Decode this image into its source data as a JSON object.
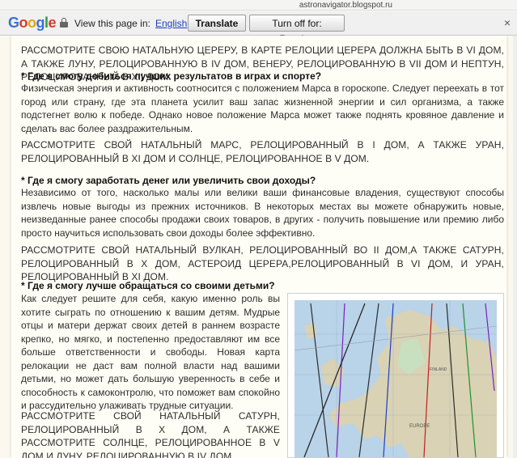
{
  "browser": {
    "url": "astronavigator.blogspot.ru"
  },
  "translate_bar": {
    "logo": "Google",
    "view_text": "View this page in:",
    "language": "English",
    "translate_label": "Translate",
    "turn_off_label": "Turn off for: Russian",
    "close": "×"
  },
  "article": {
    "p0": "РАССМОТРИТЕ СВОЮ НАТАЛЬНУЮ ЦЕРЕРУ, В КАРТЕ РЕЛОЦИИ ЦЕРЕРА ДОЛЖНА БЫТЬ В VI ДОМ, А ТАКЖЕ ЛУНУ, РЕЛОЦИРОВАННУЮ В IV ДОМ, ВЕНЕРУ, РЕЛОЦИРОВАННУЮ В VII ДОМ И НЕПТУН, РЕЛОЦИРОВАННЫЙ В XII ДОМ.",
    "h1": "* Где я смогу добиться лучших результатов в играх и спорте?",
    "p1": "Физическая энергия и активность соотносится с положением Марса в гороскопе. Следует переехать в тот город или страну, где эта планета усилит ваш запас жизненной энергии и сил организма, а также подстегнет волю к победе. Однако новое положение Марса может также поднять кровяное давление и сделать вас более раздражительным.",
    "p1c": "РАССМОТРИТЕ СВОЙ НАТАЛЬНЫЙ МАРС, РЕЛОЦИРОВАННЫЙ В I ДОМ, А ТАКЖЕ УРАН, РЕЛОЦИРОВАННЫЙ В XI ДОМ И СОЛНЦЕ, РЕЛОЦИРОВАННОЕ В V ДОМ.",
    "h2": "* Где я смогу заработать денег или увеличить свои доходы?",
    "p2": "Независимо от того, насколько малы или велики ваши финансовые владения, существуют способы извлечь новые выгоды из прежних источников. В некоторых местах вы можете обнаружить новые, неизведанные ранее способы продажи своих товаров, в других - получить повышение или премию либо просто научиться использовать свои доходы более эффективно.",
    "p2c": "РАССМОТРИТЕ СВОЙ НАТАЛЬНЫЙ ВУЛКАН, РЕЛОЦИРОВАННЫЙ ВО II ДОМ,А ТАКЖЕ САТУРН, РЕЛОЦИРОВАННЫЙ В X ДОМ, АСТЕРОИД ЦЕРЕРА,РЕЛОЦИРОВАННЫЙ В VI ДОМ, И УРАН, РЕЛОЦИРОВАННЫЙ В XI ДОМ.",
    "h3": "* Где я смогу лучше обращаться со своими детьми?",
    "p3": "Как следует решите для себя, какую именно роль вы хотите сыграть по отношению к вашим детям. Мудрые отцы и матери держат своих детей в раннем возрасте крепко, но мягко, и постепенно предоставляют им все больше ответственности и свободы. Новая карта релокации не даст вам полной власти над вашими детьми, но может дать большую уверенность в себе и способность к самоконтролю, что поможет вам спокойно и рассудительно улаживать трудные ситуации.",
    "p3c": "РАССМОТРИТЕ СВОЙ НАТАЛЬНЫЙ САТУРН, РЕЛОЦИРОВАННЫЙ В X ДОМ, А ТАКЖЕ РАССМОТРИТЕ СОЛНЦЕ, РЕЛОЦИРОВАННОЕ В V ДОМ И ЛУНУ, РЕЛОЦИРОВАННУЮ В IV ДОМ."
  },
  "map_labels": {
    "country": "FINLAND",
    "region": "EUROPE"
  },
  "colors": {
    "accent_link": "#1a3fbf",
    "background": "#fbf9ef",
    "map_sea": "#b9d3e8",
    "map_land": "#d9d2b4"
  }
}
